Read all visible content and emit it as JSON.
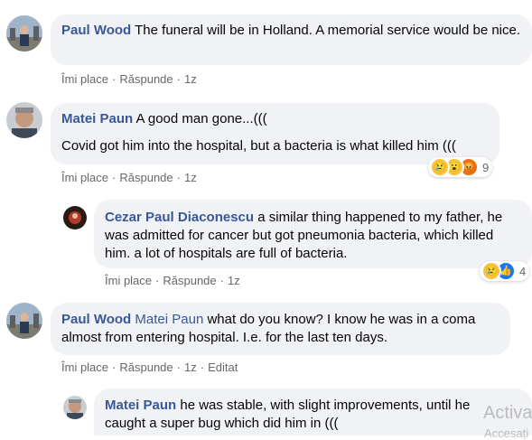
{
  "comments": [
    {
      "author": "Paul Wood",
      "text": "The funeral will be in Holland. A memorial service would be nice.",
      "actions": {
        "like": "Îmi place",
        "reply": "Răspunde",
        "time": "1z"
      }
    },
    {
      "author": "Matei Paun",
      "text_line1": "A good man gone...(((",
      "text_line2": "Covid got him into the hospital, but a bacteria is what killed him (((",
      "actions": {
        "like": "Îmi place",
        "reply": "Răspunde",
        "time": "1z"
      },
      "reactions": {
        "icons": [
          "sad-icon",
          "wow-icon",
          "angry-icon"
        ],
        "count": "9"
      }
    },
    {
      "author": "Cezar Paul Diaconescu",
      "text": "a similar thing happened to my father, he was admitted for cancer but got pneumonia bacteria, which killed him. a lot of hospitals are full of bacteria.",
      "actions": {
        "like": "Îmi place",
        "reply": "Răspunde",
        "time": "1z"
      },
      "reactions": {
        "icons": [
          "sad-icon",
          "like-icon"
        ],
        "count": "4"
      }
    },
    {
      "author": "Paul Wood",
      "mention": "Matei Paun",
      "text": "what do you know? I know he was in a coma almost from entering hospital. I.e. for the last ten days.",
      "actions": {
        "like": "Îmi place",
        "reply": "Răspunde",
        "time": "1z",
        "edited": "Editat"
      }
    },
    {
      "author": "Matei Paun",
      "text": "he was stable, with slight improvements, until he caught a super bug which did him in ((("
    }
  ],
  "watermark": {
    "line1": "Activa",
    "line2": "Accesați"
  },
  "colors": {
    "bubble": "#f0f2f5",
    "author": "#385898",
    "meta": "#65676b"
  }
}
